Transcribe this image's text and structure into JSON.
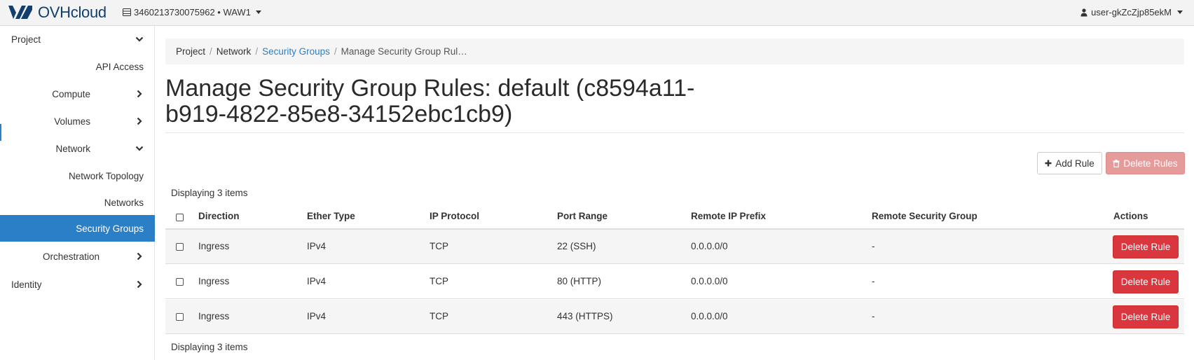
{
  "brand": {
    "name": "OVHcloud",
    "accent": "#2a7fc6",
    "logo_color": "#123f6d"
  },
  "topbar": {
    "project_id": "3460213730075962",
    "region": "WAW1",
    "project_label": "3460213730075962 • WAW1",
    "user": "user-gkZcZjp85ekM"
  },
  "sidebar": {
    "items": [
      {
        "label": "Project",
        "icon": "chevron-down-icon"
      },
      {
        "label": "API Access"
      },
      {
        "label": "Compute",
        "icon": "chevron-right-icon"
      },
      {
        "label": "Volumes",
        "icon": "chevron-right-icon"
      },
      {
        "label": "Network",
        "icon": "chevron-down-icon"
      },
      {
        "label": "Network Topology"
      },
      {
        "label": "Networks"
      },
      {
        "label": "Security Groups",
        "active": true
      },
      {
        "label": "Orchestration",
        "icon": "chevron-right-icon"
      },
      {
        "label": "Identity",
        "icon": "chevron-right-icon"
      }
    ]
  },
  "breadcrumb": {
    "items": [
      "Project",
      "Network",
      "Security Groups",
      "Manage Security Group Rul…"
    ]
  },
  "page": {
    "title": "Manage Security Group Rules: default (c8594a11-b919-4822-85e8-34152ebc1cb9)"
  },
  "actions": {
    "add_rule": "Add Rule",
    "delete_rules": "Delete Rules"
  },
  "table": {
    "count_top": "Displaying 3 items",
    "count_bottom": "Displaying 3 items",
    "columns": [
      "Direction",
      "Ether Type",
      "IP Protocol",
      "Port Range",
      "Remote IP Prefix",
      "Remote Security Group",
      "Actions"
    ],
    "rows": [
      {
        "direction": "Ingress",
        "ether_type": "IPv4",
        "protocol": "TCP",
        "port_range": "22 (SSH)",
        "remote_ip": "0.0.0.0/0",
        "remote_group": "-",
        "action": "Delete Rule"
      },
      {
        "direction": "Ingress",
        "ether_type": "IPv4",
        "protocol": "TCP",
        "port_range": "80 (HTTP)",
        "remote_ip": "0.0.0.0/0",
        "remote_group": "-",
        "action": "Delete Rule"
      },
      {
        "direction": "Ingress",
        "ether_type": "IPv4",
        "protocol": "TCP",
        "port_range": "443 (HTTPS)",
        "remote_ip": "0.0.0.0/0",
        "remote_group": "-",
        "action": "Delete Rule"
      }
    ]
  }
}
